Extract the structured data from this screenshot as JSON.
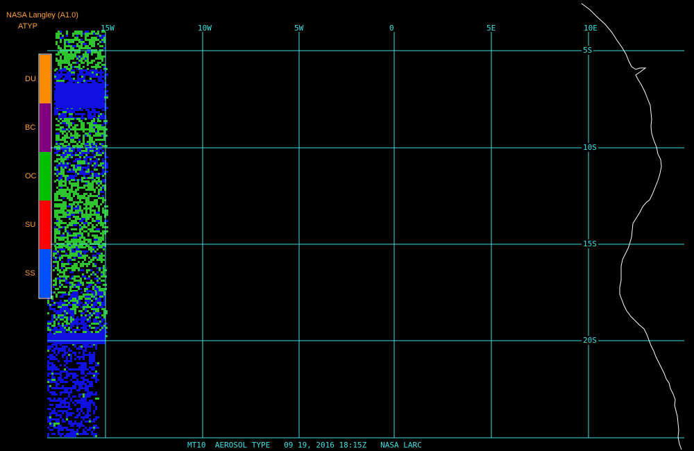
{
  "header": {
    "title": "NASA Langley (A1.0)",
    "product": "ATYP"
  },
  "footer": {
    "caption": "MT10  AEROSOL TYPE   09 19, 2016 18:15Z   NASA LARC"
  },
  "grid": {
    "longitude_labels": [
      "15W",
      "10W",
      "5W",
      "0",
      "5E",
      "10E"
    ],
    "latitude_labels": [
      "5S",
      "10S",
      "15S",
      "20S"
    ],
    "color": "#40e0e0"
  },
  "legend": {
    "items": [
      {
        "code": "DU",
        "color": "#ff8c00"
      },
      {
        "code": "BC",
        "color": "#800080"
      },
      {
        "code": "OC",
        "color": "#00c000"
      },
      {
        "code": "SU",
        "color": "#ff0000"
      },
      {
        "code": "SS",
        "color": "#0050ff"
      }
    ]
  },
  "colors": {
    "background": "#000000",
    "coastline": "#ffffff",
    "header_text": "#ffa040",
    "aerosol_green": "#2ec42e",
    "aerosol_blue": "#1010e0"
  }
}
